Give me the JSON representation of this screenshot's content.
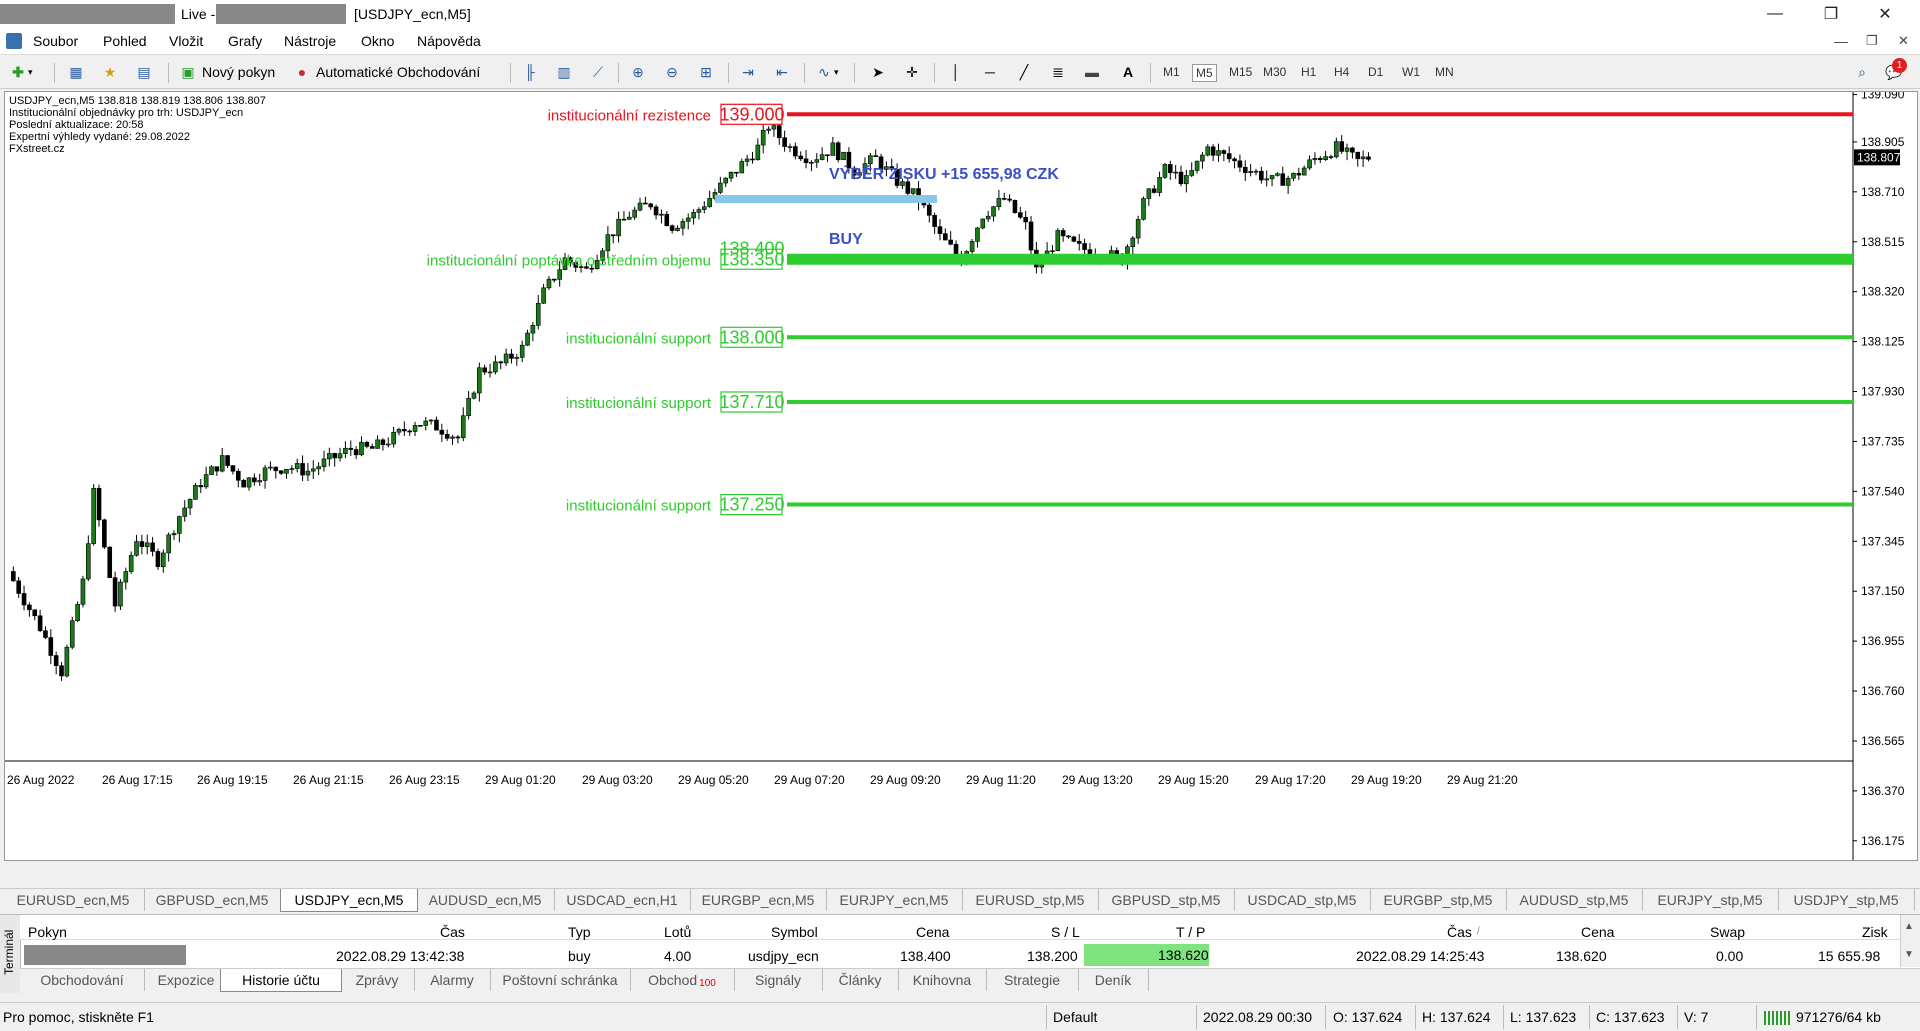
{
  "window": {
    "title_live": "Live -",
    "title_main": "[USDJPY_ecn,M5]",
    "minimize_glyph": "—",
    "restore_glyph": "❐",
    "close_glyph": "✕"
  },
  "menu": [
    "Soubor",
    "Pohled",
    "Vložit",
    "Grafy",
    "Nástroje",
    "Okno",
    "Nápověda"
  ],
  "toolbar": {
    "new_order": "Nový pokyn",
    "auto_trading": "Automatické Obchodování",
    "text_tool": "A",
    "timeframes": [
      "M1",
      "M5",
      "M15",
      "M30",
      "H1",
      "H4",
      "D1",
      "W1",
      "MN"
    ],
    "active_timeframe": "M5",
    "notification_count": "1"
  },
  "chart_info": [
    "USDJPY_ecn,M5  138.818 138.819 138.806 138.807",
    "Institucionální objednávky pro trh: USDJPY_ecn",
    "Poslední aktualizace: 20:58",
    "Expertní výhledy vydané: 29.08.2022",
    "FXstreet.cz"
  ],
  "colors": {
    "resistance": "#e8141e",
    "support": "#2ecc2e",
    "takeprofit_band": "#87c7e8",
    "annotation_blue": "#3a4fc8",
    "candle_up": "#1a7a1a",
    "candle_down": "#000000"
  },
  "chart_data": {
    "type": "candlestick",
    "symbol": "USDJPY_ecn",
    "timeframe": "M5",
    "ylim": [
      136.1,
      139.1
    ],
    "price_ticks": [
      "139.090",
      "138.905",
      "138.710",
      "138.515",
      "138.320",
      "138.125",
      "137.930",
      "137.735",
      "137.540",
      "137.345",
      "137.150",
      "136.955",
      "136.760",
      "136.565",
      "136.370",
      "136.175"
    ],
    "time_ticks": [
      "26 Aug 2022",
      "26 Aug 17:15",
      "26 Aug 19:15",
      "26 Aug 21:15",
      "26 Aug 23:15",
      "29 Aug 01:20",
      "29 Aug 03:20",
      "29 Aug 05:20",
      "29 Aug 07:20",
      "29 Aug 09:20",
      "29 Aug 11:20",
      "29 Aug 13:20",
      "29 Aug 15:20",
      "29 Aug 17:20",
      "29 Aug 19:20",
      "29 Aug 21:20"
    ],
    "current_price": "138.807",
    "approx_close_path": [
      [
        0,
        136.95
      ],
      [
        6,
        136.7
      ],
      [
        10,
        136.5
      ],
      [
        14,
        136.9
      ],
      [
        16,
        137.3
      ],
      [
        20,
        136.8
      ],
      [
        24,
        137.1
      ],
      [
        28,
        137.0
      ],
      [
        32,
        137.2
      ],
      [
        36,
        137.35
      ],
      [
        40,
        137.45
      ],
      [
        44,
        137.35
      ],
      [
        48,
        137.4
      ],
      [
        52,
        137.42
      ],
      [
        56,
        137.4
      ],
      [
        60,
        137.45
      ],
      [
        64,
        137.5
      ],
      [
        68,
        137.5
      ],
      [
        72,
        137.55
      ],
      [
        76,
        137.62
      ],
      [
        80,
        137.6
      ],
      [
        84,
        137.55
      ],
      [
        88,
        137.85
      ],
      [
        92,
        137.88
      ],
      [
        96,
        137.95
      ],
      [
        100,
        138.2
      ],
      [
        104,
        138.35
      ],
      [
        108,
        138.3
      ],
      [
        112,
        138.45
      ],
      [
        116,
        138.55
      ],
      [
        120,
        138.6
      ],
      [
        124,
        138.5
      ],
      [
        128,
        138.55
      ],
      [
        132,
        138.65
      ],
      [
        136,
        138.75
      ],
      [
        140,
        138.85
      ],
      [
        142,
        138.95
      ],
      [
        146,
        138.85
      ],
      [
        150,
        138.8
      ],
      [
        154,
        138.85
      ],
      [
        158,
        138.75
      ],
      [
        162,
        138.8
      ],
      [
        166,
        138.7
      ],
      [
        170,
        138.62
      ],
      [
        174,
        138.45
      ],
      [
        178,
        138.35
      ],
      [
        182,
        138.55
      ],
      [
        186,
        138.62
      ],
      [
        190,
        138.5
      ],
      [
        192,
        138.3
      ],
      [
        196,
        138.45
      ],
      [
        200,
        138.4
      ],
      [
        204,
        138.38
      ],
      [
        208,
        138.35
      ],
      [
        212,
        138.6
      ],
      [
        216,
        138.75
      ],
      [
        220,
        138.7
      ],
      [
        224,
        138.85
      ],
      [
        228,
        138.8
      ],
      [
        232,
        138.75
      ],
      [
        236,
        138.7
      ],
      [
        240,
        138.72
      ],
      [
        244,
        138.8
      ],
      [
        248,
        138.85
      ],
      [
        252,
        138.79
      ],
      [
        254,
        138.807
      ]
    ],
    "levels": [
      {
        "label": "institucionální rezistence",
        "value": "139.000",
        "kind": "resistance"
      },
      {
        "label": "institucionální poptávka o středním objemu",
        "value": "138.350",
        "value_hidden": "138.400",
        "kind": "demand"
      },
      {
        "label": "institucionální support",
        "value": "138.000",
        "kind": "support"
      },
      {
        "label": "institucionální support",
        "value": "137.710",
        "kind": "support"
      },
      {
        "label": "institucionální support",
        "value": "137.250",
        "kind": "support"
      }
    ],
    "annotations": {
      "profit": "VÝBĚR ZISKU +15 655,98 CZK",
      "buy": "BUY",
      "tp_price": 138.62,
      "entry_price": 138.4
    }
  },
  "symbol_tabs": [
    "EURUSD_ecn,M5",
    "GBPUSD_ecn,M5",
    "USDJPY_ecn,M5",
    "AUDUSD_ecn,M5",
    "USDCAD_ecn,H1",
    "EURGBP_ecn,M5",
    "EURJPY_ecn,M5",
    "EURUSD_stp,M5",
    "GBPUSD_stp,M5",
    "USDCAD_stp,M5",
    "EURGBP_stp,M5",
    "AUDUSD_stp,M5",
    "EURJPY_stp,M5",
    "USDJPY_stp,M5"
  ],
  "active_symbol_tab": "USDJPY_ecn,M5",
  "terminal": {
    "side_label": "Terminál",
    "headers": [
      "Pokyn",
      "Čas",
      "Typ",
      "Lotů",
      "Symbol",
      "Cena",
      "S / L",
      "T / P",
      "Čas",
      "Cena",
      "Swap",
      "Zisk"
    ],
    "sort_indicator": "/",
    "row": {
      "open_time": "2022.08.29 13:42:38",
      "type": "buy",
      "lots": "4.00",
      "symbol": "usdjpy_ecn",
      "open_price": "138.400",
      "sl": "138.200",
      "tp": "138.620",
      "close_time": "2022.08.29 14:25:43",
      "close_price": "138.620",
      "swap": "0.00",
      "profit": "15 655.98"
    }
  },
  "bottom_tabs": [
    "Obchodování",
    "Expozice",
    "Historie účtu",
    "Zprávy",
    "Alarmy",
    "Poštovní schránka",
    "Obchod",
    "Signály",
    "Články",
    "Knihovna",
    "Strategie",
    "Deník"
  ],
  "bottom_tab_badge": "100",
  "active_bottom_tab": "Historie účtu",
  "status": {
    "help": "Pro pomoc, stiskněte F1",
    "profile": "Default",
    "datetime": "2022.08.29 00:30",
    "open": "O: 137.624",
    "high": "H: 137.624",
    "low": "L: 137.623",
    "close": "C: 137.623",
    "volume": "V: 7",
    "traffic": "971276/64 kb"
  }
}
